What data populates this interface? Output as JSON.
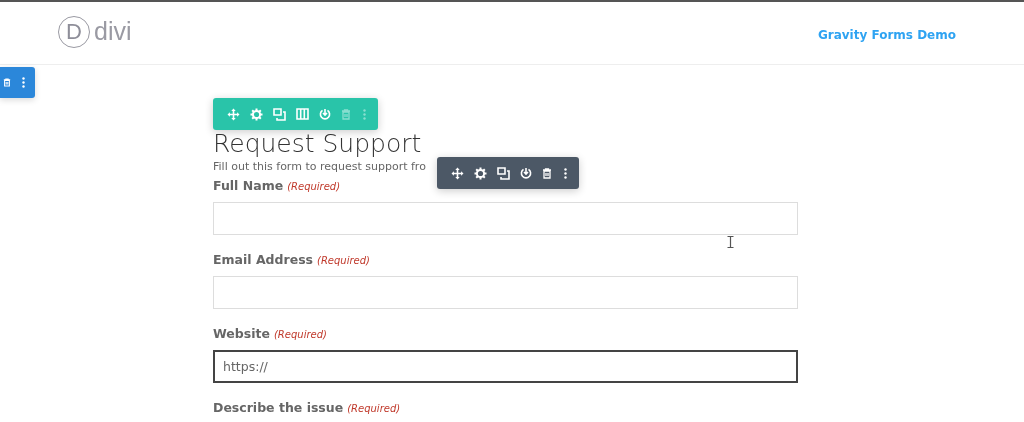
{
  "header": {
    "logo_mark": "D",
    "logo_text": "divi",
    "nav": [
      {
        "label": "Gravity Forms Demo"
      }
    ]
  },
  "side_toolbar": {
    "buttons": [
      {
        "kind": "trash",
        "disabled": false
      },
      {
        "kind": "dots",
        "disabled": false
      }
    ]
  },
  "form": {
    "title": "Request Support",
    "description": "Fill out this form to request support fro",
    "fields": [
      {
        "label": "Full Name",
        "required": "(Required)",
        "input": {
          "focused": false
        }
      },
      {
        "label": "Email Address",
        "required": "(Required)",
        "input": {
          "focused": false
        }
      },
      {
        "label": "Website",
        "required": "(Required)",
        "input": {
          "value": "https://",
          "focused": true
        }
      },
      {
        "label": "Describe the issue",
        "required": "(Required)"
      }
    ]
  },
  "toolbars": [
    {
      "kind": "row",
      "buttons": [
        {
          "kind": "move",
          "disabled": false
        },
        {
          "kind": "gear",
          "disabled": false
        },
        {
          "kind": "duplicate",
          "disabled": false
        },
        {
          "kind": "columns",
          "disabled": false
        },
        {
          "kind": "power",
          "disabled": false
        },
        {
          "kind": "trash",
          "disabled": true
        },
        {
          "kind": "dots",
          "disabled": true
        }
      ]
    },
    {
      "kind": "module",
      "buttons": [
        {
          "kind": "move",
          "disabled": false
        },
        {
          "kind": "gear",
          "disabled": false
        },
        {
          "kind": "duplicate",
          "disabled": false
        },
        {
          "kind": "power",
          "disabled": false
        },
        {
          "kind": "trash",
          "disabled": false
        },
        {
          "kind": "dots",
          "disabled": false
        }
      ]
    }
  ]
}
